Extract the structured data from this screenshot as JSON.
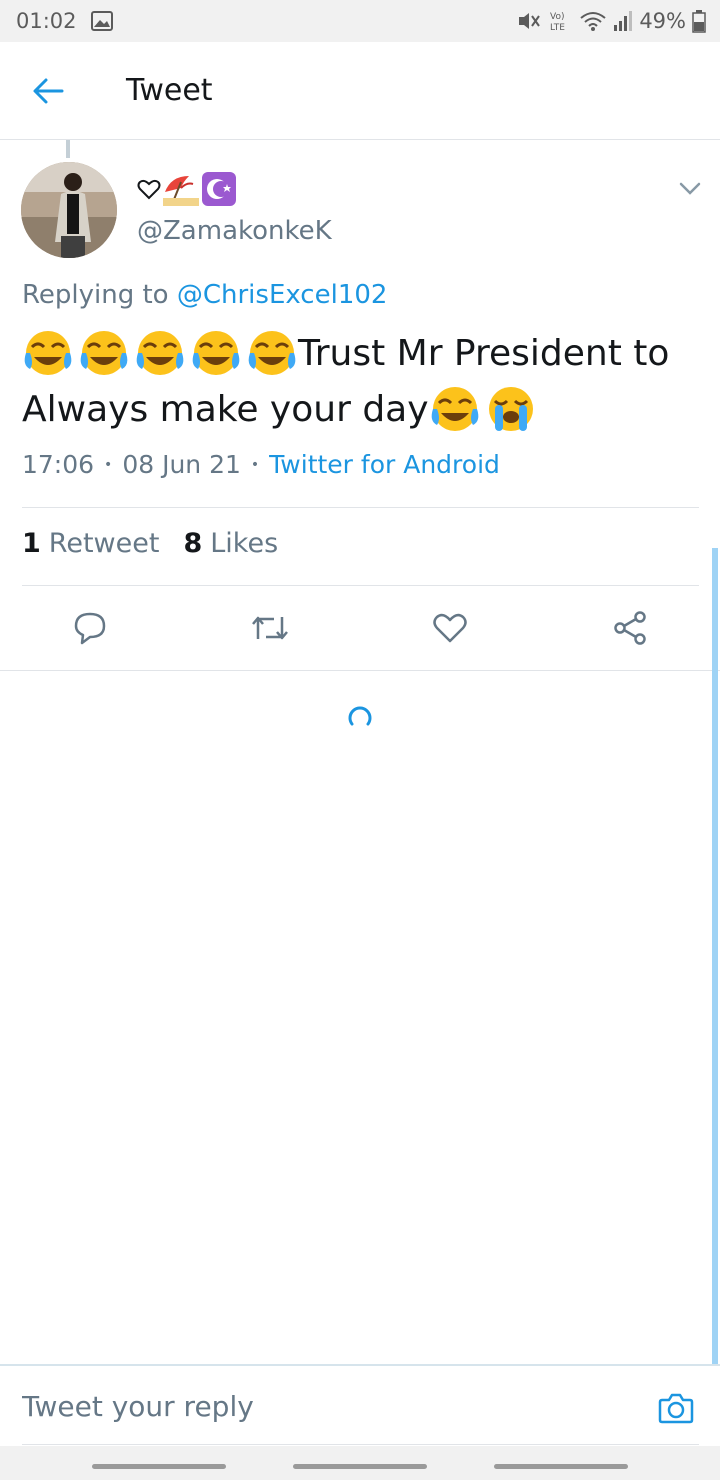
{
  "status_bar": {
    "time": "01:02",
    "battery": "49%",
    "network_label": "Vo) LTE"
  },
  "app_bar": {
    "title": "Tweet"
  },
  "tweet": {
    "display_name_emojis": [
      "heart-outline",
      "beach-umbrella",
      "star-and-crescent"
    ],
    "handle": "@ZamakonkeK",
    "replying_prefix": "Replying to ",
    "replying_to": "@ChrisExcel102",
    "text_leading_emojis": [
      "face-with-tears-of-joy",
      "face-with-tears-of-joy",
      "face-with-tears-of-joy",
      "face-with-tears-of-joy",
      "face-with-tears-of-joy"
    ],
    "text": "Trust Mr President to Always make your day",
    "text_trailing_emojis": [
      "face-with-tears-of-joy",
      "loudly-crying-face"
    ],
    "time": "17:06",
    "date": "08 Jun 21",
    "source": "Twitter for Android",
    "separator": "•",
    "retweet_count": "1",
    "retweet_label": "Retweet",
    "like_count": "8",
    "like_label": "Likes"
  },
  "reply": {
    "placeholder": "Tweet your reply"
  },
  "colors": {
    "accent": "#1b95e0",
    "secondary_text": "#657786",
    "primary_text": "#14171a",
    "divider": "#e1e4e8"
  }
}
